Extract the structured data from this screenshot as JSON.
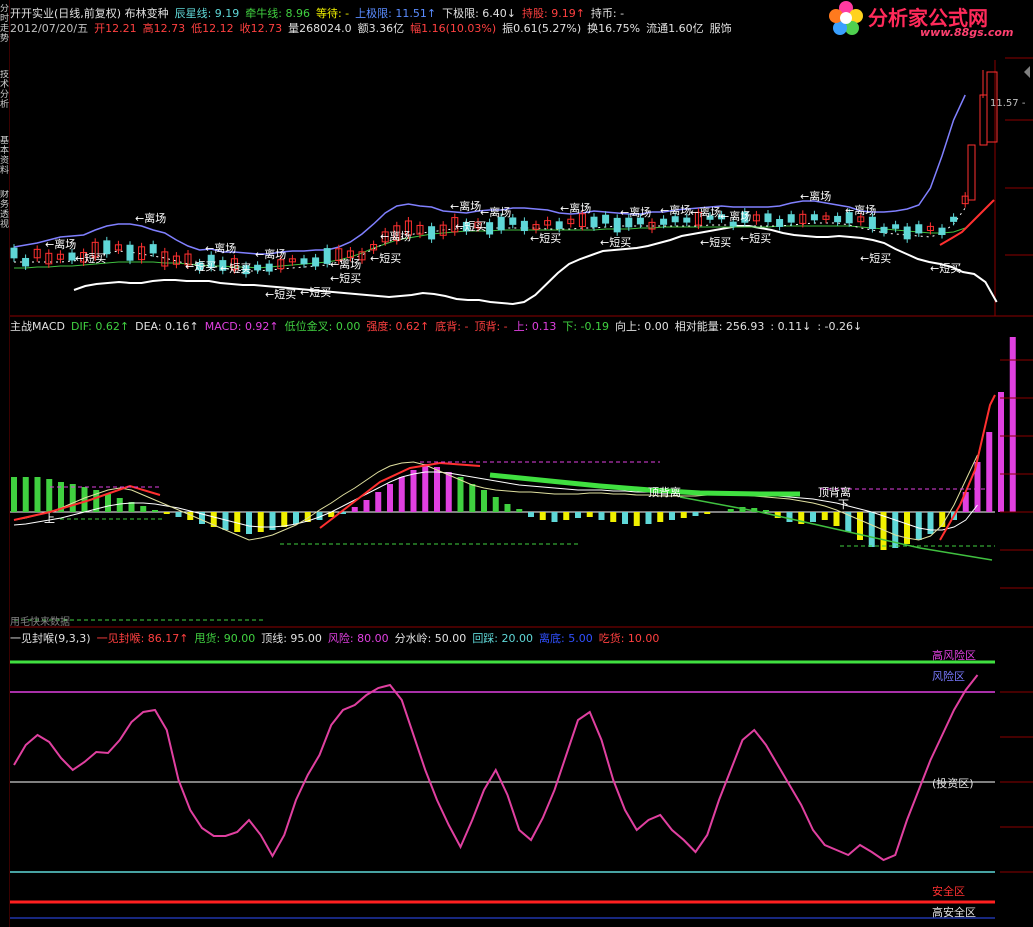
{
  "header": {
    "row1": [
      {
        "text": "开开实业(日线,前复权) 布林变种",
        "color": "#e0e0e0"
      },
      {
        "text": "辰星线: 9.19",
        "color": "#5fd7d7"
      },
      {
        "text": "牵牛线: 8.96",
        "color": "#40d040"
      },
      {
        "text": "等待: -",
        "color": "#f0f000"
      },
      {
        "text": "上极限: 11.51↑",
        "color": "#5a8cff"
      },
      {
        "text": "下极限: 6.40↓",
        "color": "#e0e0e0"
      },
      {
        "text": "持股: 9.19↑",
        "color": "#ff4040"
      },
      {
        "text": "持币: -",
        "color": "#e0e0e0"
      }
    ],
    "row2": [
      {
        "text": "2012/07/20/五",
        "color": "#c0c0c0"
      },
      {
        "text": "开12.21",
        "color": "#ff4040"
      },
      {
        "text": "高12.73",
        "color": "#ff4040"
      },
      {
        "text": "低12.12",
        "color": "#ff4040"
      },
      {
        "text": "收12.73",
        "color": "#ff4040"
      },
      {
        "text": "量268024.0",
        "color": "#e0e0e0"
      },
      {
        "text": "额3.36亿",
        "color": "#e0e0e0"
      },
      {
        "text": "幅1.16(10.03%)",
        "color": "#ff4040"
      },
      {
        "text": "振0.61(5.27%)",
        "color": "#e0e0e0"
      },
      {
        "text": "换16.75%",
        "color": "#e0e0e0"
      },
      {
        "text": "流通1.60亿",
        "color": "#e0e0e0"
      },
      {
        "text": "服饰",
        "color": "#e0e0e0"
      }
    ]
  },
  "sidebar": {
    "tabs": [
      "分时走势",
      "技术分析",
      "基本资料",
      "财务透视"
    ]
  },
  "logo": {
    "name": "分析家公式网",
    "url_text": "www.88gs.com"
  },
  "price_panel": {
    "price_label": "11.57",
    "signals": {
      "leave": "←离场",
      "buy": "←短买"
    }
  },
  "macd_panel": {
    "items": [
      {
        "text": "主战MACD",
        "color": "#e0e0e0"
      },
      {
        "text": "DIF: 0.62↑",
        "color": "#40d040"
      },
      {
        "text": "DEA: 0.16↑",
        "color": "#e0e0e0"
      },
      {
        "text": "MACD: 0.92↑",
        "color": "#e040e0"
      },
      {
        "text": "低位金叉: 0.00",
        "color": "#40d040"
      },
      {
        "text": "强度: 0.62↑",
        "color": "#ff4040"
      },
      {
        "text": "底背: -",
        "color": "#ff4040"
      },
      {
        "text": "顶背: -",
        "color": "#ff4040"
      },
      {
        "text": "上: 0.13",
        "color": "#e040e0"
      },
      {
        "text": "下: -0.19",
        "color": "#40d040"
      },
      {
        "text": "向上: 0.00",
        "color": "#e0e0e0"
      },
      {
        "text": "相对能量: 256.93",
        "color": "#e0e0e0"
      },
      {
        "text": ": 0.11↓",
        "color": "#e0e0e0"
      },
      {
        "text": ": -0.26↓",
        "color": "#e0e0e0"
      }
    ],
    "labels": {
      "top_div_a": "顶背离",
      "top_div_b": "顶背离",
      "up": "上",
      "down": "下"
    },
    "footer": "用毛快来数据"
  },
  "osc_panel": {
    "items": [
      {
        "text": "一见封喉(9,3,3)",
        "color": "#e0e0e0"
      },
      {
        "text": "一见封喉: 86.17↑",
        "color": "#ff4040"
      },
      {
        "text": "甩货: 90.00",
        "color": "#40d040"
      },
      {
        "text": "顶线: 95.00",
        "color": "#e0e0e0"
      },
      {
        "text": "风险: 80.00",
        "color": "#e040e0"
      },
      {
        "text": "分水岭: 50.00",
        "color": "#e0e0e0"
      },
      {
        "text": "回踩: 20.00",
        "color": "#5fd7d7"
      },
      {
        "text": "离底: 5.00",
        "color": "#3050ff"
      },
      {
        "text": "吃货: 10.00",
        "color": "#ff4040"
      }
    ],
    "zones": {
      "high_risk": "高风险区",
      "risk": "风险区",
      "invest": "(投资区)",
      "safe": "安全区",
      "high_safe": "高安全区"
    }
  }
}
